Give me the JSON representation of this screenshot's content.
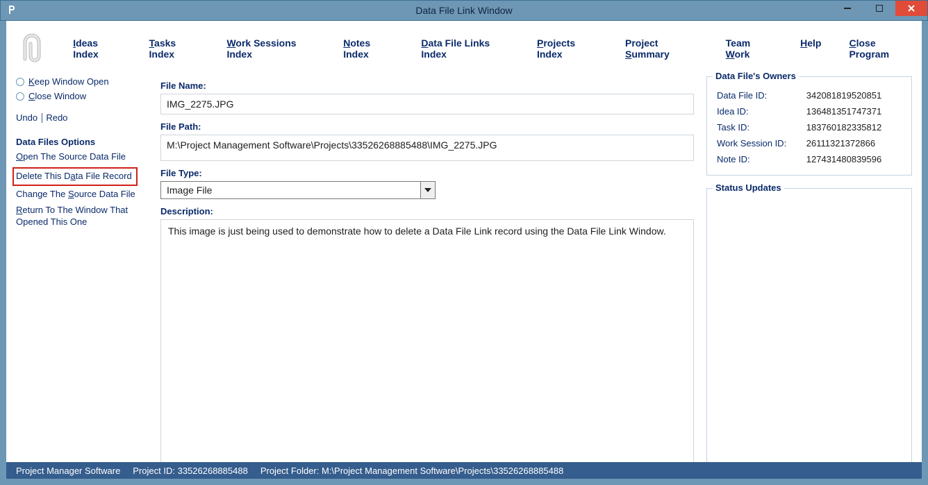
{
  "window": {
    "title": "Data File Link Window"
  },
  "menu": {
    "ideas": "deas Index",
    "tasks": "asks Index",
    "work": "ork Sessions Index",
    "notes": "otes Index",
    "data": "ata File Links Index",
    "projects": "rojects Index",
    "summary_pre": "roject ",
    "summary_post": "ummary",
    "team_pre": "eam ",
    "team_post": "ork",
    "help": "elp",
    "close": "lose Program"
  },
  "sidebar": {
    "keep_open": "eep Window Open",
    "close_window": "lose Window",
    "undo": "Undo",
    "redo": "Redo",
    "section": "Data Files Options",
    "open_src": "pen The Source Data File",
    "delete": "elete This D",
    "delete_post": "ta File Record",
    "change_pre": "Change The ",
    "change_post": "ource Data File",
    "return_pre": "eturn To The Window That Opened This One"
  },
  "form": {
    "filename_label": "File Name:",
    "filename_value": "IMG_2275.JPG",
    "filepath_label": "File Path:",
    "filepath_value": "M:\\Project Management Software\\Projects\\33526268885488\\IMG_2275.JPG",
    "filetype_label": "File Type:",
    "filetype_value": "Image File",
    "description_label": "Description:",
    "description_value": "This image is just being used to demonstrate how to delete a Data File Link record using the Data File Link Window."
  },
  "owners": {
    "legend": "Data File's Owners",
    "rows": [
      {
        "label": "Data File ID:",
        "value": "342081819520851"
      },
      {
        "label": "Idea ID:",
        "value": "136481351747371"
      },
      {
        "label": "Task ID:",
        "value": "183760182335812"
      },
      {
        "label": "Work Session ID:",
        "value": "26111321372866"
      },
      {
        "label": "Note ID:",
        "value": "127431480839596"
      }
    ]
  },
  "status": {
    "legend": "Status Updates"
  },
  "statusbar": {
    "app": "Project Manager Software",
    "project_id_label": "Project ID: ",
    "project_id_value": "33526268885488",
    "folder_label": "Project Folder: ",
    "folder_value": "M:\\Project Management Software\\Projects\\33526268885488"
  }
}
